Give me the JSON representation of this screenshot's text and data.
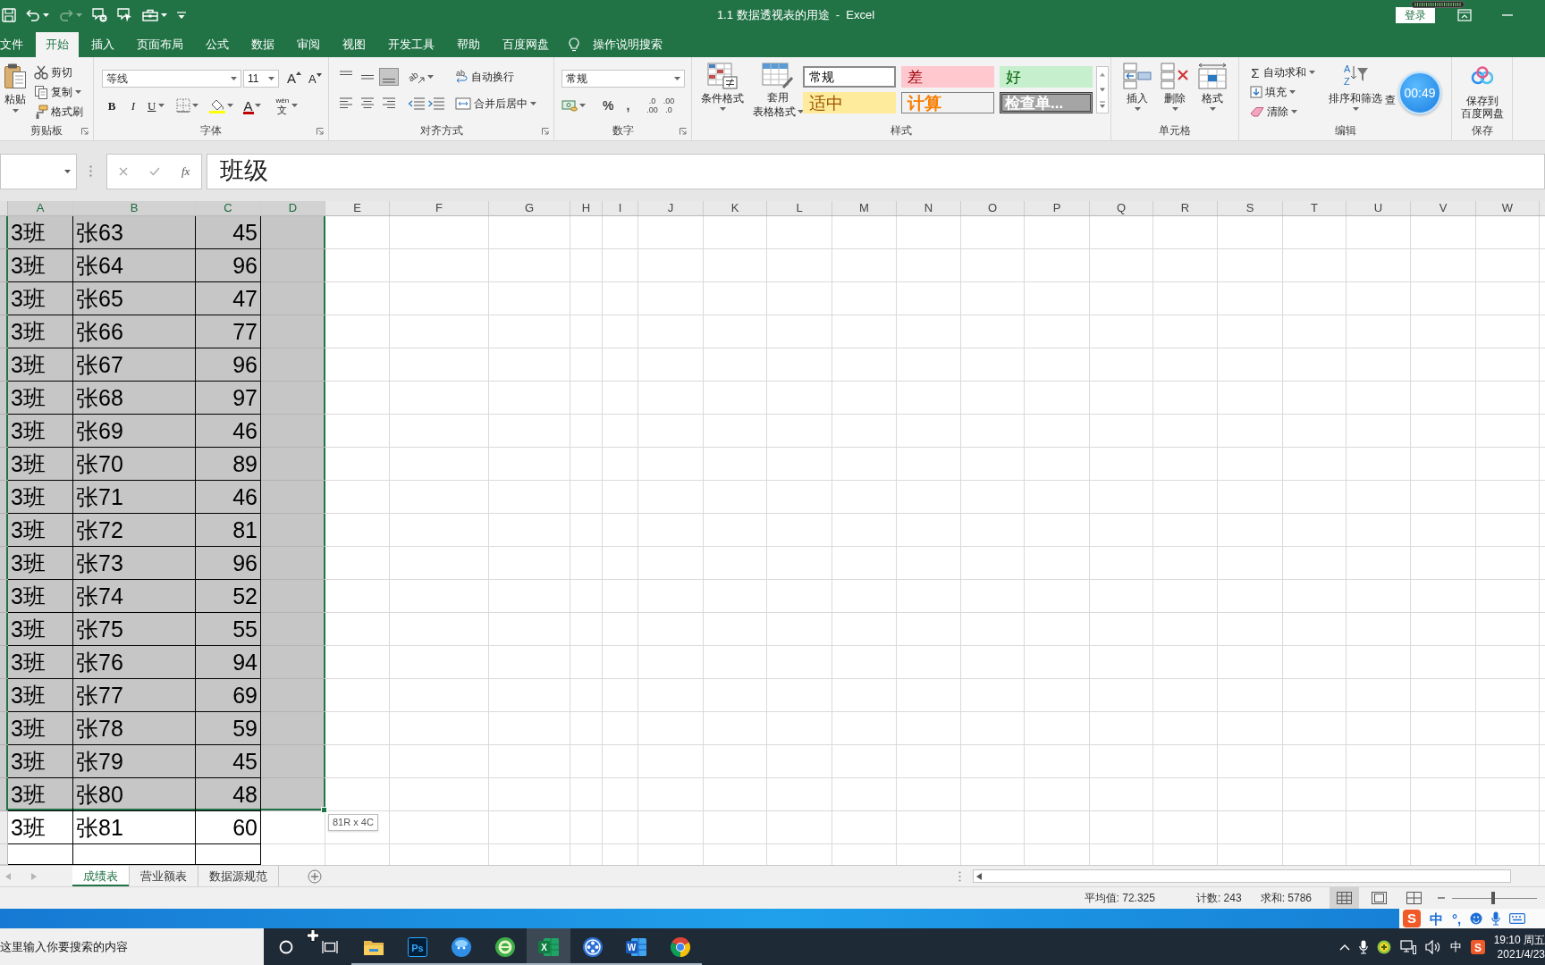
{
  "window": {
    "title": "1.1 数据透视表的用途  -  Excel",
    "sign_in": "登录"
  },
  "quick_access": [
    {
      "kind": "save",
      "disabled": false
    },
    {
      "kind": "undo",
      "disabled": false
    },
    {
      "kind": "redo",
      "disabled": true
    },
    {
      "kind": "clear",
      "disabled": false
    },
    {
      "kind": "pointer",
      "disabled": false
    },
    {
      "kind": "toolbox",
      "disabled": false
    },
    {
      "kind": "customize",
      "disabled": false
    }
  ],
  "tabs": [
    {
      "label": "文件",
      "selected": false
    },
    {
      "label": "开始",
      "selected": true
    },
    {
      "label": "插入",
      "selected": false
    },
    {
      "label": "页面布局",
      "selected": false
    },
    {
      "label": "公式",
      "selected": false
    },
    {
      "label": "数据",
      "selected": false
    },
    {
      "label": "审阅",
      "selected": false
    },
    {
      "label": "视图",
      "selected": false
    },
    {
      "label": "开发工具",
      "selected": false
    },
    {
      "label": "帮助",
      "selected": false
    },
    {
      "label": "百度网盘",
      "selected": false
    }
  ],
  "tell_me": "操作说明搜索",
  "ribbon": [
    {
      "kind": "clipboard",
      "label": "剪贴板",
      "launcher": true,
      "paste": "粘贴",
      "commands": [
        {
          "kind": "cut",
          "label": "剪切",
          "dropdown": false
        },
        {
          "kind": "copy",
          "label": "复制",
          "dropdown": true
        },
        {
          "kind": "painter",
          "label": "格式刷",
          "dropdown": false
        }
      ]
    },
    {
      "kind": "font",
      "label": "字体",
      "launcher": true,
      "font_name": "等线",
      "font_size": "11",
      "grow": "A",
      "shrink": "A",
      "styles": [
        "B",
        "I",
        "U"
      ],
      "font_color": "A",
      "phonetic": [
        "wén",
        "文"
      ]
    },
    {
      "kind": "alignment",
      "label": "对齐方式",
      "launcher": true,
      "vertical": [
        {
          "kind": "top",
          "selected": false
        },
        {
          "kind": "middle",
          "selected": false
        },
        {
          "kind": "bottom",
          "selected": true
        }
      ],
      "orientation": "ab",
      "wrap_icon": "ab",
      "wrap": "自动换行",
      "horizontal": [
        {
          "kind": "left",
          "selected": false
        },
        {
          "kind": "center",
          "selected": false
        },
        {
          "kind": "right",
          "selected": false
        }
      ],
      "merge": "合并后居中"
    },
    {
      "kind": "number",
      "label": "数字",
      "launcher": true,
      "format": "常规",
      "percent": "%",
      "comma": ",",
      "increase_decimal": [
        ".0",
        ".00"
      ],
      "decrease_decimal": [
        ".00",
        ".0"
      ]
    },
    {
      "kind": "styles",
      "label": "样式",
      "conditional": "条件格式",
      "table_format": [
        "套用",
        "表格格式"
      ],
      "gallery": [
        {
          "kind": "normal",
          "label": "常规",
          "selected": true
        },
        {
          "kind": "bad",
          "label": "差",
          "selected": false
        },
        {
          "kind": "good",
          "label": "好",
          "selected": false
        },
        {
          "kind": "neutral",
          "label": "适中",
          "selected": false
        },
        {
          "kind": "calculation",
          "label": "计算",
          "selected": false
        },
        {
          "kind": "check",
          "label": "检查单...",
          "selected": false
        }
      ]
    },
    {
      "kind": "cells",
      "label": "单元格",
      "commands": [
        {
          "kind": "insert",
          "label": "插入"
        },
        {
          "kind": "delete",
          "label": "删除"
        },
        {
          "kind": "format",
          "label": "格式"
        }
      ]
    },
    {
      "kind": "editing",
      "label": "编辑",
      "sum_sign": "Σ",
      "autosum": "自动求和",
      "fill": "填充",
      "clear": "清除",
      "sort_letters": [
        "A",
        "Z"
      ],
      "sort": "排序和筛选",
      "find": "查"
    },
    {
      "kind": "save",
      "label": "保存",
      "command": [
        "保存到",
        "百度网盘"
      ]
    }
  ],
  "timer": "00:49",
  "formula_bar": {
    "function_label": "fx",
    "value": "班级"
  },
  "sheet": {
    "columns": [
      {
        "label": "A",
        "selected": true
      },
      {
        "label": "B",
        "selected": true
      },
      {
        "label": "C",
        "selected": true
      },
      {
        "label": "D",
        "selected": true
      },
      {
        "label": "E",
        "selected": false
      },
      {
        "label": "F",
        "selected": false
      },
      {
        "label": "G",
        "selected": false
      },
      {
        "label": "H",
        "selected": false
      },
      {
        "label": "I",
        "selected": false
      },
      {
        "label": "J",
        "selected": false
      },
      {
        "label": "K",
        "selected": false
      },
      {
        "label": "L",
        "selected": false
      },
      {
        "label": "M",
        "selected": false
      },
      {
        "label": "N",
        "selected": false
      },
      {
        "label": "O",
        "selected": false
      },
      {
        "label": "P",
        "selected": false
      },
      {
        "label": "Q",
        "selected": false
      },
      {
        "label": "R",
        "selected": false
      },
      {
        "label": "S",
        "selected": false
      },
      {
        "label": "T",
        "selected": false
      },
      {
        "label": "U",
        "selected": false
      },
      {
        "label": "V",
        "selected": false
      },
      {
        "label": "W",
        "selected": false
      }
    ],
    "rows": [
      {
        "selected": true,
        "cells": [
          "3班",
          "张63",
          "45"
        ]
      },
      {
        "selected": true,
        "cells": [
          "3班",
          "张64",
          "96"
        ]
      },
      {
        "selected": true,
        "cells": [
          "3班",
          "张65",
          "47"
        ]
      },
      {
        "selected": true,
        "cells": [
          "3班",
          "张66",
          "77"
        ]
      },
      {
        "selected": true,
        "cells": [
          "3班",
          "张67",
          "96"
        ]
      },
      {
        "selected": true,
        "cells": [
          "3班",
          "张68",
          "97"
        ]
      },
      {
        "selected": true,
        "cells": [
          "3班",
          "张69",
          "46"
        ]
      },
      {
        "selected": true,
        "cells": [
          "3班",
          "张70",
          "89"
        ]
      },
      {
        "selected": true,
        "cells": [
          "3班",
          "张71",
          "46"
        ]
      },
      {
        "selected": true,
        "cells": [
          "3班",
          "张72",
          "81"
        ]
      },
      {
        "selected": true,
        "cells": [
          "3班",
          "张73",
          "96"
        ]
      },
      {
        "selected": true,
        "cells": [
          "3班",
          "张74",
          "52"
        ]
      },
      {
        "selected": true,
        "cells": [
          "3班",
          "张75",
          "55"
        ]
      },
      {
        "selected": true,
        "cells": [
          "3班",
          "张76",
          "94"
        ]
      },
      {
        "selected": true,
        "cells": [
          "3班",
          "张77",
          "69"
        ]
      },
      {
        "selected": true,
        "cells": [
          "3班",
          "张78",
          "59"
        ]
      },
      {
        "selected": true,
        "cells": [
          "3班",
          "张79",
          "45"
        ]
      },
      {
        "selected": true,
        "cells": [
          "3班",
          "张80",
          "48"
        ]
      },
      {
        "selected": false,
        "cells": [
          "3班",
          "张81",
          "60"
        ]
      }
    ],
    "selection_tip": "81R x 4C"
  },
  "sheet_tabs": [
    {
      "label": "成绩表",
      "selected": true
    },
    {
      "label": "营业额表",
      "selected": false
    },
    {
      "label": "数据源规范",
      "selected": false
    }
  ],
  "status_bar": {
    "stats": [
      "平均值: 72.325",
      "计数: 243",
      "求和: 5786"
    ],
    "views": [
      {
        "kind": "normal",
        "selected": true
      },
      {
        "kind": "page_layout",
        "selected": false
      },
      {
        "kind": "page_break",
        "selected": false
      }
    ],
    "zoom": {
      "level": 0.48
    }
  },
  "ime_toolbar": {
    "logo": "S",
    "mode": "中",
    "punctuation": "°,"
  },
  "taskbar": {
    "search": {
      "placeholder": "这里输入你要搜索的内容"
    },
    "apps": [
      {
        "kind": "search_circle",
        "running": false,
        "selected": false
      },
      {
        "kind": "task_view",
        "running": false,
        "selected": false
      },
      {
        "kind": "folder",
        "running": true,
        "selected": false
      },
      {
        "kind": "ps_tile",
        "label": "Ps",
        "running": true,
        "selected": false
      },
      {
        "kind": "round_face",
        "running": true,
        "selected": false
      },
      {
        "kind": "swirl",
        "running": true,
        "selected": false
      },
      {
        "kind": "x_tile",
        "label": "X",
        "running": true,
        "selected": true
      },
      {
        "kind": "film_reel",
        "running": true,
        "selected": false
      },
      {
        "kind": "w_tile",
        "label": "W",
        "running": true,
        "selected": false
      },
      {
        "kind": "browser",
        "running": true,
        "selected": false
      }
    ],
    "tray": [
      {
        "kind": "chevron"
      },
      {
        "kind": "mic"
      },
      {
        "kind": "plus_badge"
      },
      {
        "kind": "network"
      },
      {
        "kind": "volume"
      },
      {
        "kind": "ime",
        "label": "中"
      },
      {
        "kind": "s_logo",
        "label": "S"
      }
    ],
    "time": "19:10 周五",
    "date": "2021/4/23"
  }
}
